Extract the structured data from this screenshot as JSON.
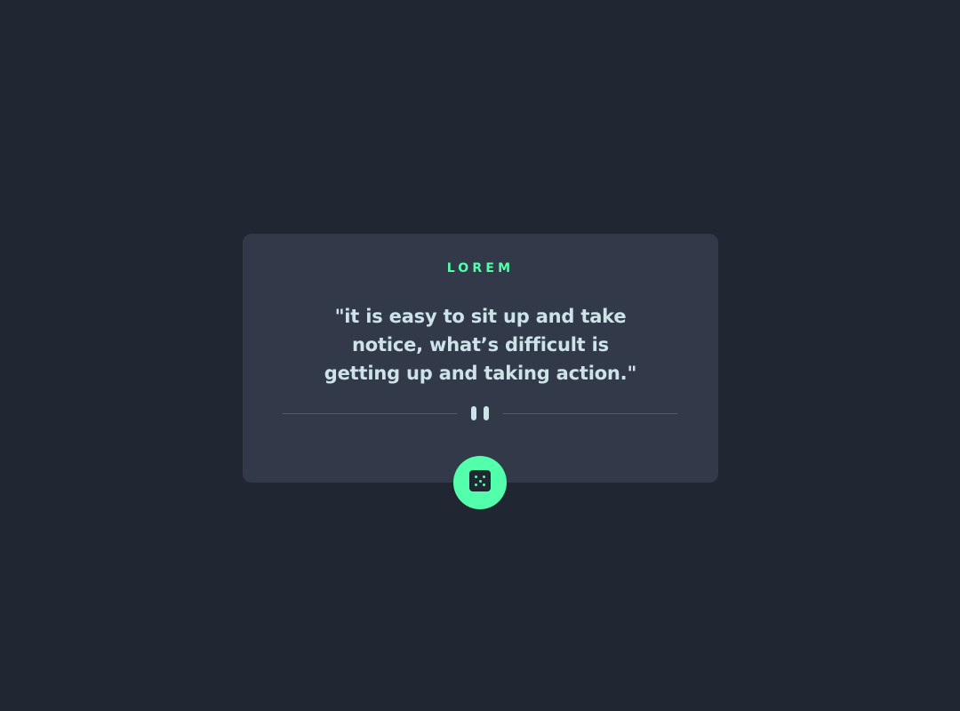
{
  "card": {
    "eyebrow": "LOREM",
    "quote": "\"it is easy to sit up and take notice, what’s difficult is getting up and taking action.\""
  },
  "icons": {
    "divider_icon": "pause-icon",
    "button_icon": "dice-icon"
  },
  "colors": {
    "page_background": "#202632",
    "card_background": "#323a49",
    "accent": "#53ffaa",
    "quote_text": "#cee3e9",
    "divider_line": "#4f5d74"
  }
}
